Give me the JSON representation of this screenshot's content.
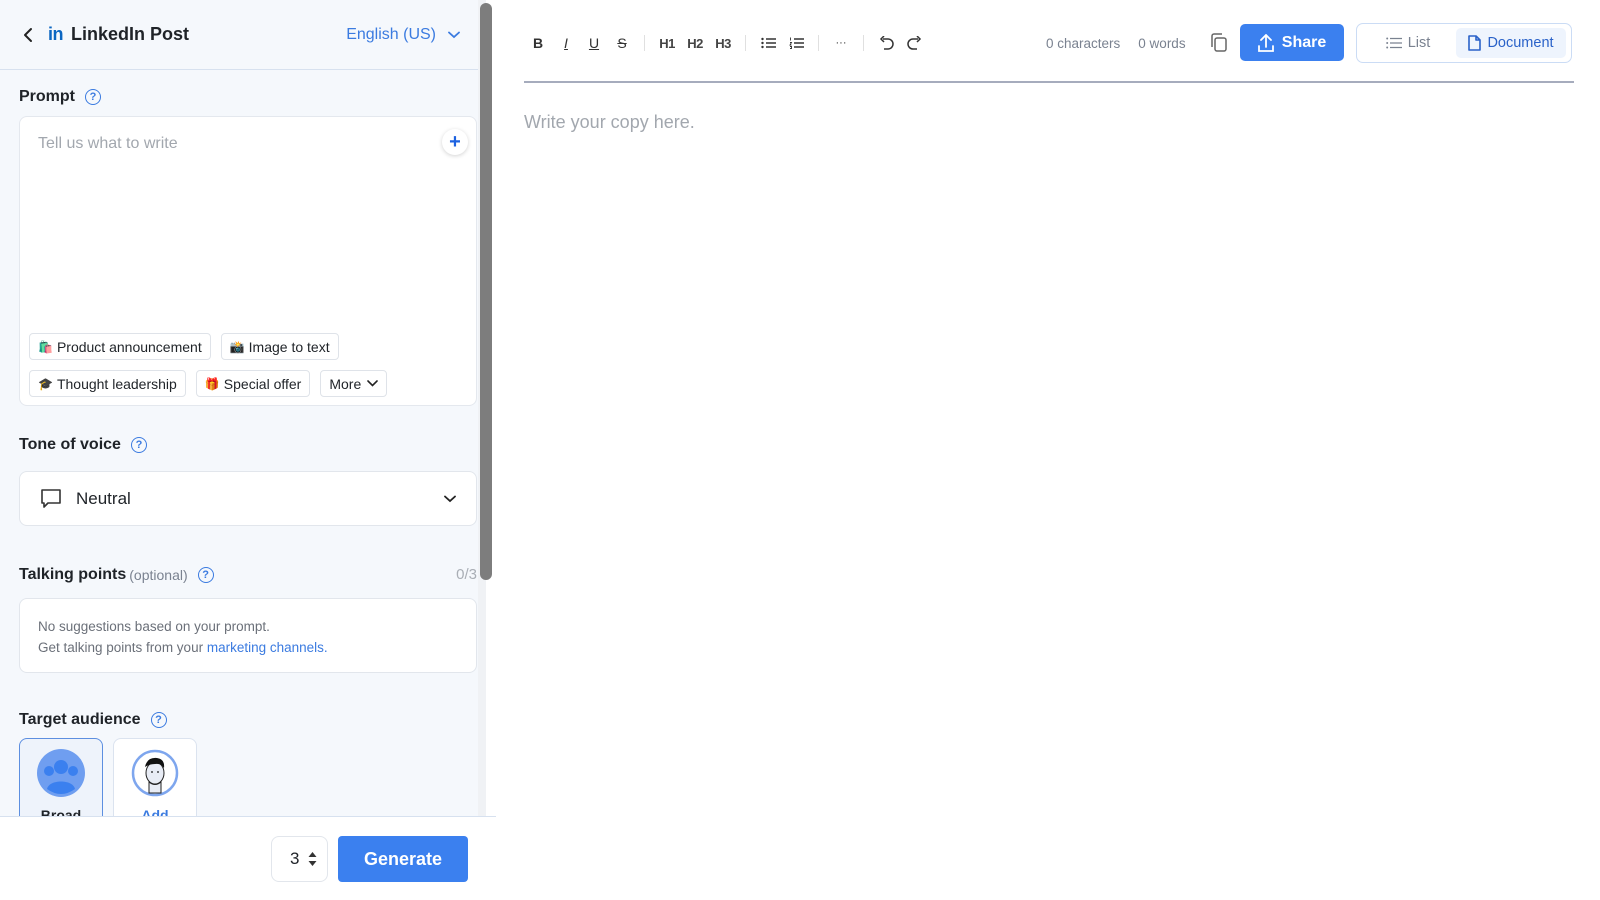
{
  "header": {
    "back_icon": "chevron-left-icon",
    "platform_logo": "in",
    "title": "LinkedIn Post",
    "language": "English (US)"
  },
  "prompt": {
    "label": "Prompt",
    "placeholder": "Tell us what to write",
    "value": "",
    "add_icon": "+",
    "chips": [
      {
        "emoji": "🛍️",
        "label": "Product announcement"
      },
      {
        "emoji": "📸",
        "label": "Image to text"
      },
      {
        "emoji": "🎓",
        "label": "Thought leadership"
      },
      {
        "emoji": "🎁",
        "label": "Special offer"
      },
      {
        "emoji": "",
        "label": "More"
      }
    ]
  },
  "tone": {
    "label": "Tone of voice",
    "selected": "Neutral"
  },
  "talking_points": {
    "label": "Talking points",
    "optional": "(optional)",
    "count": "0/3",
    "line1": "No suggestions based on your prompt.",
    "line2_prefix": "Get talking points from your ",
    "line2_link": "marketing channels."
  },
  "target_audience": {
    "label": "Target audience",
    "options": [
      {
        "label": "Broad",
        "selected": true
      },
      {
        "label": "Add",
        "selected": false
      }
    ]
  },
  "footer": {
    "variant_count": "3",
    "generate_label": "Generate"
  },
  "editor": {
    "toolbar": {
      "bold": "B",
      "italic": "I",
      "underline": "U",
      "strike": "S",
      "h1": "H1",
      "h2": "H2",
      "h3": "H3",
      "more": "···"
    },
    "characters": "0 characters",
    "words": "0 words",
    "share_label": "Share",
    "view_list": "List",
    "view_document": "Document",
    "active_view": "Document",
    "placeholder": "Write your copy here.",
    "value": ""
  },
  "colors": {
    "accent": "#3b80ef",
    "link": "#3b7be0",
    "linkedin": "#0a66c2"
  }
}
